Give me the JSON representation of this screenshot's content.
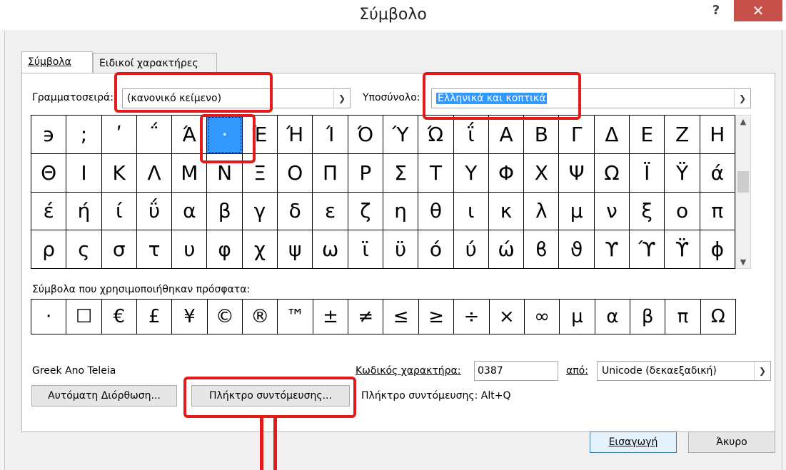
{
  "window": {
    "title": "Σύμβολο",
    "help_label": "?",
    "close_label": "✕"
  },
  "tabs": [
    {
      "label": "Σύμβολα",
      "active": true
    },
    {
      "label": "Ειδικοί χαρακτήρες",
      "active": false
    }
  ],
  "font": {
    "label": "Γραμματοσειρά:",
    "value": "(κανονικό κείμενο)"
  },
  "subset": {
    "label": "Υποσύνολο:",
    "value": "Ελληνικά και κοπτικά"
  },
  "symbol_grid": {
    "rows": [
      [
        "϶",
        ";",
        "ʹ",
        "΅",
        "Ά",
        "·",
        "Έ",
        "Ή",
        "Ί",
        "Ό",
        "Ύ",
        "Ώ",
        "ΐ",
        "Α",
        "Β",
        "Γ",
        "Δ",
        "Ε",
        "Ζ",
        "Η"
      ],
      [
        "Θ",
        "Ι",
        "Κ",
        "Λ",
        "Μ",
        "Ν",
        "Ξ",
        "Ο",
        "Π",
        "Ρ",
        "Σ",
        "Τ",
        "Υ",
        "Φ",
        "Χ",
        "Ψ",
        "Ω",
        "Ϊ",
        "Ϋ",
        "ά"
      ],
      [
        "έ",
        "ή",
        "ί",
        "ΰ",
        "α",
        "β",
        "γ",
        "δ",
        "ε",
        "ζ",
        "η",
        "θ",
        "ι",
        "κ",
        "λ",
        "μ",
        "ν",
        "ξ",
        "ο",
        "π"
      ],
      [
        "ρ",
        "ς",
        "σ",
        "τ",
        "υ",
        "φ",
        "χ",
        "ψ",
        "ω",
        "ϊ",
        "ϋ",
        "ό",
        "ύ",
        "ώ",
        "ϐ",
        "ϑ",
        "ϒ",
        "ϓ",
        "ϔ",
        "ϕ"
      ]
    ],
    "selected": {
      "row": 0,
      "col": 5
    }
  },
  "recent": {
    "label": "Σύμβολα που χρησιμοποιήθηκαν πρόσφατα:",
    "symbols": [
      "·",
      "☐",
      "€",
      "£",
      "¥",
      "©",
      "®",
      "™",
      "±",
      "≠",
      "≤",
      "≥",
      "÷",
      "×",
      "∞",
      "µ",
      "α",
      "β",
      "π",
      "Ω"
    ]
  },
  "char_name": "Greek Ano Teleia",
  "char_code": {
    "label": "Κωδικός χαρακτήρα:",
    "value": "0387"
  },
  "from": {
    "label": "από:",
    "value": "Unicode (δεκαεξαδική)"
  },
  "buttons": {
    "autocorrect": "Αυτόματη Διόρθωση...",
    "shortcut_key": "Πλήκτρο συντόμευσης...",
    "insert": "Εισαγωγή",
    "cancel": "Άκυρο"
  },
  "shortcut_info": "Πλήκτρο συντόμευσης: Alt+Q",
  "colors": {
    "accent": "#3399ff",
    "close": "#c7504a",
    "annotation": "#e21a1a"
  }
}
